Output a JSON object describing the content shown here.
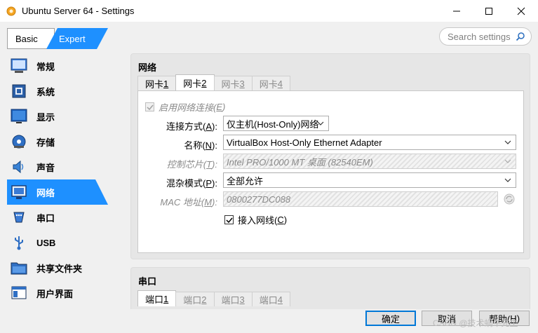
{
  "window": {
    "title": "Ubuntu Server 64 - Settings"
  },
  "mode": {
    "basic": "Basic",
    "expert": "Expert"
  },
  "search": {
    "placeholder": "Search settings"
  },
  "sidebar": {
    "items": [
      {
        "label": "常规",
        "icon": "general-icon"
      },
      {
        "label": "系统",
        "icon": "system-icon"
      },
      {
        "label": "显示",
        "icon": "display-icon"
      },
      {
        "label": "存储",
        "icon": "storage-icon"
      },
      {
        "label": "声音",
        "icon": "audio-icon"
      },
      {
        "label": "网络",
        "icon": "network-icon",
        "active": true
      },
      {
        "label": "串口",
        "icon": "serial-port-icon"
      },
      {
        "label": "USB",
        "icon": "usb-icon"
      },
      {
        "label": "共享文件夹",
        "icon": "shared-folder-icon"
      },
      {
        "label": "用户界面",
        "icon": "user-interface-icon"
      }
    ]
  },
  "network": {
    "title": "网络",
    "tabs": [
      {
        "pre": "网卡 ",
        "key": "1",
        "state": "normal"
      },
      {
        "pre": "网卡 ",
        "key": "2",
        "state": "active"
      },
      {
        "pre": "网卡 ",
        "key": "3",
        "state": "disabled"
      },
      {
        "pre": "网卡 ",
        "key": "4",
        "state": "disabled"
      }
    ],
    "enable_adapter": {
      "pre": "启用网络连接(",
      "key": "E",
      "post": ")",
      "checked": true
    },
    "attached_to": {
      "pre": "连接方式(",
      "key": "A",
      "post": "):",
      "value": "仅主机(Host-Only)网络"
    },
    "name": {
      "pre": "名称(",
      "key": "N",
      "post": "):",
      "value": "VirtualBox Host-Only Ethernet Adapter"
    },
    "adapter_type": {
      "pre": "控制芯片(",
      "key": "T",
      "post": "):",
      "value": "Intel PRO/1000 MT 桌面 (82540EM)"
    },
    "promiscuous": {
      "pre": "混杂模式(",
      "key": "P",
      "post": "):",
      "value": "全部允许"
    },
    "mac": {
      "pre": "MAC 地址(",
      "key": "M",
      "post": "):",
      "value": "0800277DC088"
    },
    "cable_connected": {
      "pre": "接入网线(",
      "key": "C",
      "post": ")",
      "checked": true
    }
  },
  "serial": {
    "title": "串口",
    "tabs": [
      {
        "pre": "端口 ",
        "key": "1",
        "state": "active"
      },
      {
        "pre": "端口 ",
        "key": "2",
        "state": "disabled"
      },
      {
        "pre": "端口 ",
        "key": "3",
        "state": "disabled"
      },
      {
        "pre": "端口 ",
        "key": "4",
        "state": "disabled"
      }
    ]
  },
  "buttons": {
    "ok": "确定",
    "cancel": {
      "pre": "取消",
      "key": "",
      "post": ""
    },
    "help": {
      "pre": "帮助(",
      "key": "H",
      "post": ")"
    }
  },
  "watermark": "CSDN @技术蜗牛先生",
  "colors": {
    "accent": "#1e90ff",
    "default_button_border": "#0078d7"
  }
}
